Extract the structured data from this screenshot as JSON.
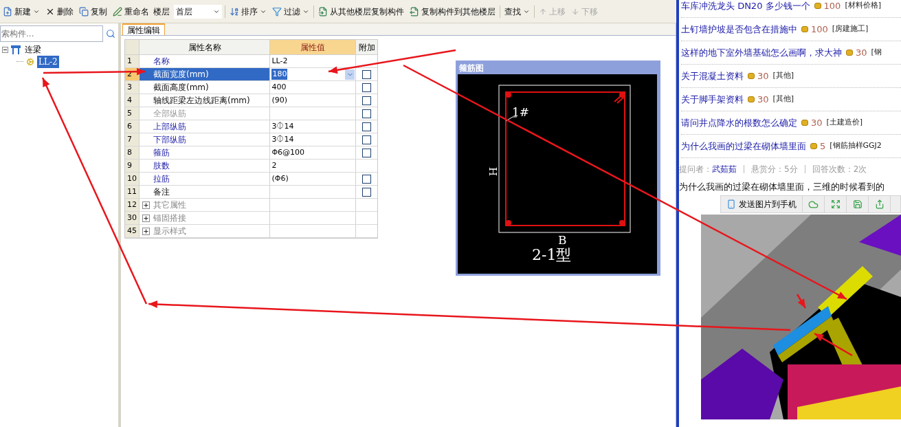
{
  "toolbar": [
    {
      "kind": "button",
      "label": "新建",
      "dropdown": true,
      "disabled": false
    },
    {
      "kind": "button",
      "label": "删除",
      "dropdown": false,
      "disabled": false
    },
    {
      "kind": "button",
      "label": "复制",
      "dropdown": false,
      "disabled": false
    },
    {
      "kind": "button",
      "label": "重命名",
      "dropdown": false,
      "disabled": false
    },
    {
      "kind": "select",
      "label": "楼层",
      "value": "首层"
    },
    {
      "kind": "separator"
    },
    {
      "kind": "button",
      "label": "排序",
      "dropdown": true,
      "disabled": false
    },
    {
      "kind": "button",
      "label": "过滤",
      "dropdown": true,
      "disabled": false
    },
    {
      "kind": "separator"
    },
    {
      "kind": "button",
      "label": "从其他楼层复制构件",
      "dropdown": false,
      "disabled": false
    },
    {
      "kind": "button",
      "label": "复制构件到其他楼层",
      "dropdown": false,
      "disabled": false
    },
    {
      "kind": "separator"
    },
    {
      "kind": "button",
      "label": "查找",
      "dropdown": true,
      "disabled": false
    },
    {
      "kind": "separator"
    },
    {
      "kind": "button",
      "label": "上移",
      "dropdown": false,
      "disabled": true
    },
    {
      "kind": "button",
      "label": "下移",
      "dropdown": false,
      "disabled": true
    }
  ],
  "search": {
    "placeholder": "索构件..."
  },
  "tree": [
    {
      "label": "连梁",
      "expanded": true,
      "selected": false,
      "children": [
        {
          "label": "LL-2",
          "selected": true
        }
      ]
    }
  ],
  "tabs": [
    {
      "label": "属性编辑",
      "selected": true
    }
  ],
  "table": {
    "columns": [
      "属性名称",
      "属性值",
      "附加"
    ],
    "rows": [
      {
        "num": "1",
        "name": "名称",
        "value": "LL-2",
        "kind": "link",
        "selected": false
      },
      {
        "num": "2",
        "name": "截面宽度(mm)",
        "value": "180",
        "kind": "plain",
        "selected": true,
        "addon": {
          "checked": false
        }
      },
      {
        "num": "3",
        "name": "截面高度(mm)",
        "value": "400",
        "kind": "plain",
        "selected": false,
        "addon": {
          "checked": false
        }
      },
      {
        "num": "4",
        "name": "轴线距梁左边线距离(mm)",
        "value": "(90)",
        "kind": "plain",
        "selected": false,
        "addon": {
          "checked": false
        }
      },
      {
        "num": "5",
        "name": "全部纵筋",
        "kind": "muted",
        "selected": false,
        "addon": {
          "checked": false
        }
      },
      {
        "num": "6",
        "name": "上部纵筋",
        "value": "3⏀14",
        "kind": "link",
        "selected": false,
        "addon": {
          "checked": false
        }
      },
      {
        "num": "7",
        "name": "下部纵筋",
        "value": "3⏀14",
        "kind": "link",
        "selected": false,
        "addon": {
          "checked": false
        }
      },
      {
        "num": "8",
        "name": "箍筋",
        "value": "Φ6@100",
        "kind": "link",
        "selected": false,
        "addon": {
          "checked": false
        }
      },
      {
        "num": "9",
        "name": "肢数",
        "value": "2",
        "kind": "link",
        "selected": false
      },
      {
        "num": "10",
        "name": "拉筋",
        "value": "(Φ6)",
        "kind": "link",
        "selected": false,
        "addon": {
          "checked": false
        }
      },
      {
        "num": "11",
        "name": "备注",
        "kind": "plain",
        "selected": false,
        "addon": {
          "checked": false
        }
      },
      {
        "num": "12",
        "name": "其它属性",
        "kind": "group",
        "expanded": false,
        "selected": false
      },
      {
        "num": "30",
        "name": "锚固搭接",
        "kind": "group",
        "expanded": false,
        "selected": false
      },
      {
        "num": "45",
        "name": "显示样式",
        "kind": "group",
        "expanded": false,
        "selected": false
      }
    ]
  },
  "stirrup_window": {
    "title": "箍筋图",
    "bar_label": "1#",
    "height_label": "H",
    "width_label": "B",
    "type_label": "2-1型"
  },
  "questions": [
    {
      "title": "车库冲洗龙头 DN20 多少钱一个",
      "score": "100",
      "category": "[材料价格]"
    },
    {
      "title": "土钉墙护坡是否包含在措施中",
      "score": "100",
      "category": "[房建施工]"
    },
    {
      "title": "这样的地下室外墙基础怎么画啊，求大神",
      "score": "30",
      "category": "[钢"
    },
    {
      "title": "关于混凝土资料",
      "score": "30",
      "category": "[其他]"
    },
    {
      "title": "关于脚手架资料",
      "score": "30",
      "category": "[其他]"
    },
    {
      "title": "请问井点降水的根数怎么确定",
      "score": "30",
      "category": "[土建造价]"
    },
    {
      "title": "为什么我画的过梁在砌体墙里面",
      "score": "5",
      "category": "[钢筋抽样GGJ2"
    }
  ],
  "meta": {
    "asker_label": "提问者：",
    "asker": "武茹茹",
    "reward": "悬赏分：5分",
    "answers": "回答次数：2次"
  },
  "question_text": "为什么我画的过梁在砌体墙里面，三维的时候看到的",
  "image_toolbar": {
    "send_label": "发送图片到手机"
  }
}
